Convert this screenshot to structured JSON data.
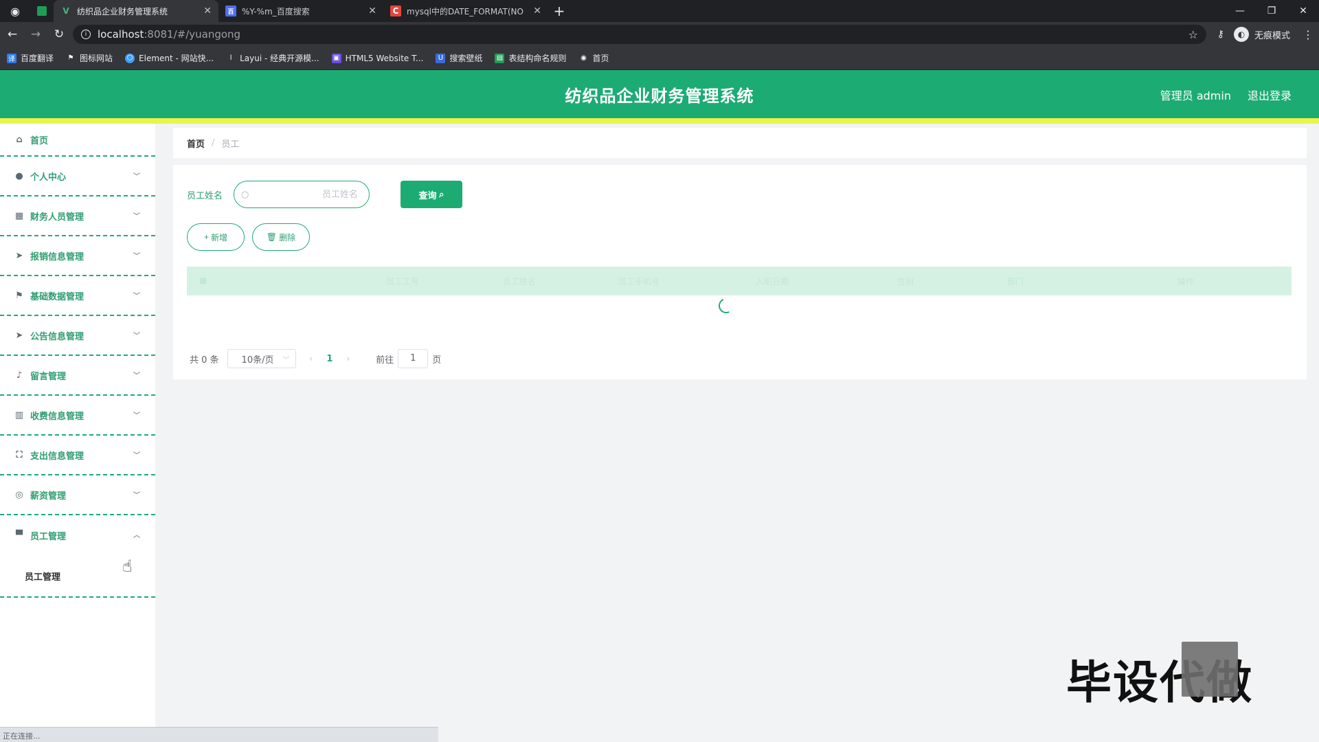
{
  "browser": {
    "tabs": [
      {
        "title": "纺织品企业财务管理系统",
        "favicon": "V",
        "favicon_color": "#41b883",
        "active": true
      },
      {
        "title": "%Y-%m_百度搜索",
        "favicon": "百",
        "favicon_color": "#4e6ef2",
        "active": false
      },
      {
        "title": "mysql中的DATE_FORMAT(NO",
        "favicon": "C",
        "favicon_color": "#e8443a",
        "active": false
      }
    ],
    "url_host": "localhost",
    "url_rest": ":8081/#/yuangong",
    "profile_label": "无痕模式",
    "bookmarks": [
      {
        "label": "百度翻译",
        "color": "#2e7be6"
      },
      {
        "label": "图标网站",
        "color": "#202124"
      },
      {
        "label": "Element - 网站快...",
        "color": "#409eff"
      },
      {
        "label": "Layui - 经典开源模...",
        "color": "#202124"
      },
      {
        "label": "HTML5 Website T...",
        "color": "#6c4fe0"
      },
      {
        "label": "搜索壁纸",
        "color": "#3a6cd8"
      },
      {
        "label": "表结构命名规则",
        "color": "#1f9d55"
      },
      {
        "label": "首页",
        "color": "#202124"
      }
    ],
    "status_text": "正在连接..."
  },
  "header": {
    "title": "纺织品企业财务管理系统",
    "user_label": "管理员 admin",
    "logout_label": "退出登录"
  },
  "sidebar": {
    "items": [
      {
        "label": "首页",
        "icon": "home-icon",
        "glyph": "⌂"
      },
      {
        "label": "个人中心",
        "icon": "user-icon",
        "glyph": "●"
      },
      {
        "label": "财务人员管理",
        "icon": "grid-icon",
        "glyph": "▦"
      },
      {
        "label": "报销信息管理",
        "icon": "send-icon",
        "glyph": "➤"
      },
      {
        "label": "基础数据管理",
        "icon": "flag-icon",
        "glyph": "⚑"
      },
      {
        "label": "公告信息管理",
        "icon": "send-icon",
        "glyph": "➤"
      },
      {
        "label": "留言管理",
        "icon": "microphone-icon",
        "glyph": "♪"
      },
      {
        "label": "收费信息管理",
        "icon": "chart-icon",
        "glyph": "▥"
      },
      {
        "label": "支出信息管理",
        "icon": "crop-icon",
        "glyph": "⛶"
      },
      {
        "label": "薪资管理",
        "icon": "coin-icon",
        "glyph": "◎"
      },
      {
        "label": "员工管理",
        "icon": "monitor-icon",
        "glyph": "▀"
      }
    ],
    "submenu_label": "员工管理"
  },
  "breadcrumb": {
    "home": "首页",
    "current": "员工"
  },
  "search": {
    "label": "员工姓名",
    "placeholder": "员工姓名",
    "query_button": "查询"
  },
  "actions": {
    "add_label": "新增",
    "delete_label": "删除"
  },
  "table": {
    "headers": [
      "",
      "",
      "员工工号",
      "员工姓名",
      "员工手机号",
      "入职日期",
      "性别",
      "部门",
      "操作"
    ]
  },
  "pagination": {
    "total_label": "共 0 条",
    "page_size": "10条/页",
    "current_page": "1",
    "goto_label": "前往",
    "goto_value": "1",
    "page_suffix": "页"
  },
  "overlay": {
    "watermark": "毕设代做"
  },
  "colors": {
    "primary": "#1dab74",
    "accent_bar": "#e8f54a"
  }
}
